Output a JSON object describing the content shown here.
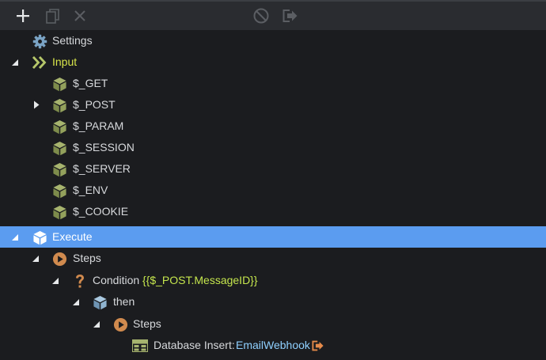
{
  "toolbar": {
    "buttons": [
      {
        "icon": "plus-icon",
        "label": "Add",
        "enabled": true
      },
      {
        "icon": "copy-icon",
        "label": "Duplicate",
        "enabled": false
      },
      {
        "icon": "close-icon",
        "label": "Remove",
        "enabled": false
      },
      {
        "icon": "disable-icon",
        "label": "Disable",
        "enabled": false
      },
      {
        "icon": "export-icon",
        "label": "Move out",
        "enabled": false
      }
    ]
  },
  "tree": {
    "settings": {
      "label": "Settings",
      "icon": "gear-icon"
    },
    "input": {
      "label": "Input",
      "icon": "double-chevron-icon",
      "expanded": true,
      "children": [
        {
          "label": "$_GET",
          "icon": "cube-icon",
          "expandable": false
        },
        {
          "label": "$_POST",
          "icon": "cube-icon",
          "expandable": true,
          "expanded": false
        },
        {
          "label": "$_PARAM",
          "icon": "cube-icon",
          "expandable": false
        },
        {
          "label": "$_SESSION",
          "icon": "cube-icon",
          "expandable": false
        },
        {
          "label": "$_SERVER",
          "icon": "cube-icon",
          "expandable": false
        },
        {
          "label": "$_ENV",
          "icon": "cube-icon",
          "expandable": false
        },
        {
          "label": "$_COOKIE",
          "icon": "cube-icon",
          "expandable": false
        }
      ]
    },
    "execute": {
      "label": "Execute",
      "icon": "cube-icon",
      "selected": true,
      "expanded": true
    },
    "steps": {
      "label": "Steps",
      "icon": "play-icon"
    },
    "condition": {
      "label": "Condition",
      "value": "{{$_POST.MessageID}}",
      "icon": "question-icon"
    },
    "then": {
      "label": "then",
      "icon": "cube-icon"
    },
    "then_steps": {
      "label": "Steps",
      "icon": "play-icon"
    },
    "db_insert": {
      "label": "Database Insert:",
      "value": "EmailWebhook",
      "icon": "table-icon",
      "link_icon": "export-icon"
    }
  },
  "colors": {
    "background": "#1b1c1f",
    "toolbar": "#2a2c30",
    "selected": "#5b9cf0",
    "input_label": "#d8e54a",
    "expression": "#c5e64d",
    "value_link": "#8fd0ff",
    "cube_green": "#8d9c5a",
    "cube_blue": "#8fb8d8",
    "play_orange": "#d08a4e"
  }
}
